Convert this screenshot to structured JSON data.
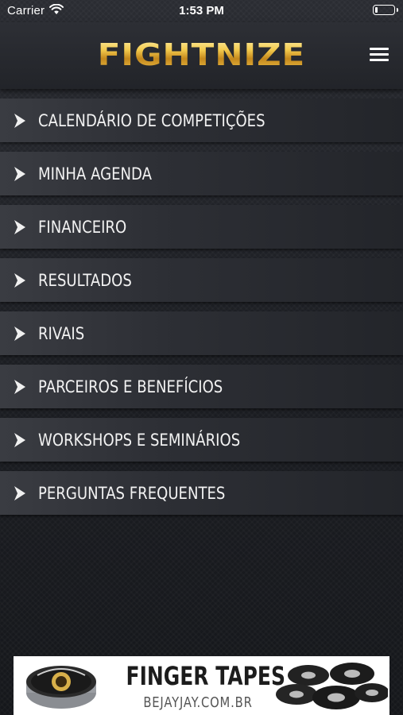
{
  "status_bar": {
    "carrier": "Carrier",
    "time": "1:53 PM",
    "battery_level": 0.15
  },
  "header": {
    "logo_text": "FIGHTNIZE",
    "menu_icon": "hamburger-menu-icon"
  },
  "menu": {
    "chevron_icon": "chevron-right-icon",
    "items": [
      {
        "label": "CALENDÁRIO DE COMPETIÇÕES"
      },
      {
        "label": "MINHA AGENDA"
      },
      {
        "label": "FINANCEIRO"
      },
      {
        "label": "RESULTADOS"
      },
      {
        "label": "RIVAIS"
      },
      {
        "label": "PARCEIROS E BENEFÍCIOS"
      },
      {
        "label": "WORKSHOPS E SEMINÁRIOS"
      },
      {
        "label": "PERGUNTAS FREQUENTES"
      }
    ]
  },
  "ad_banner": {
    "title": "FINGER TAPES",
    "url": "BEJAYJAY.COM.BR"
  },
  "colors": {
    "logo_gold": "#f2c94c",
    "menu_item_bg": "#2d2f35",
    "background": "#1b1d22"
  }
}
